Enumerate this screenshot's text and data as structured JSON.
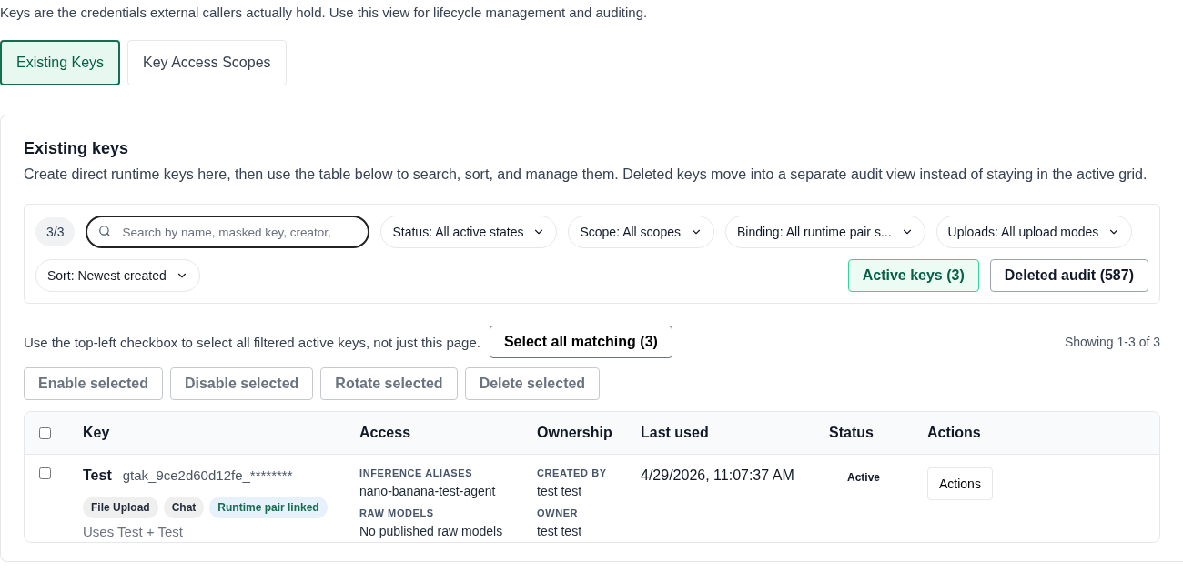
{
  "intro": "Keys are the credentials external callers actually hold. Use this view for lifecycle management and auditing.",
  "tabs": [
    {
      "label": "Existing Keys",
      "selected": true
    },
    {
      "label": "Key Access Scopes",
      "selected": false
    }
  ],
  "panel": {
    "title": "Existing keys",
    "description": "Create direct runtime keys here, then use the table below to search, sort, and manage them. Deleted keys move into a separate audit view instead of staying in the active grid.",
    "filters": {
      "count": "3/3",
      "search": {
        "placeholder": "Search by name, masked key, creator,"
      },
      "dropdowns": [
        "Status: All active states",
        "Scope: All scopes",
        "Binding: All runtime pair s...",
        "Uploads: All upload modes",
        "Sort: Newest created"
      ],
      "views": [
        {
          "label": "Active keys (3)",
          "selected": true
        },
        {
          "label": "Deleted audit (587)",
          "selected": false
        }
      ]
    },
    "selection_hint": "Use the top-left checkbox to select all filtered active keys, not just this page.",
    "select_all_button": "Select all matching (3)",
    "showing": "Showing 1-3 of 3",
    "bulk_actions": [
      {
        "label": "Enable selected",
        "disabled": true
      },
      {
        "label": "Disable selected",
        "disabled": true
      },
      {
        "label": "Rotate selected",
        "disabled": true
      },
      {
        "label": "Delete selected",
        "disabled": true
      }
    ],
    "table": {
      "header_checked": false,
      "columns": [
        "Key",
        "Access",
        "Ownership",
        "Last used",
        "Status",
        "Actions"
      ],
      "rows": [
        {
          "checked": false,
          "name": "Test",
          "masked_key": "gtak_9ce2d60d12fe_********",
          "tags": [
            {
              "label": "File Upload",
              "kind": "plain"
            },
            {
              "label": "Chat",
              "kind": "plain"
            },
            {
              "label": "Runtime pair linked",
              "kind": "linked"
            }
          ],
          "note": "Uses Test + Test",
          "access": [
            {
              "label": "INFERENCE ALIASES",
              "value": "nano-banana-test-agent"
            },
            {
              "label": "RAW MODELS",
              "value": "No published raw models"
            }
          ],
          "ownership": [
            {
              "label": "CREATED BY",
              "value": "test test"
            },
            {
              "label": "OWNER",
              "value": "test test"
            }
          ],
          "last_used": "4/29/2026, 11:07:37 AM",
          "status": "Active",
          "action": "Actions"
        }
      ]
    }
  }
}
